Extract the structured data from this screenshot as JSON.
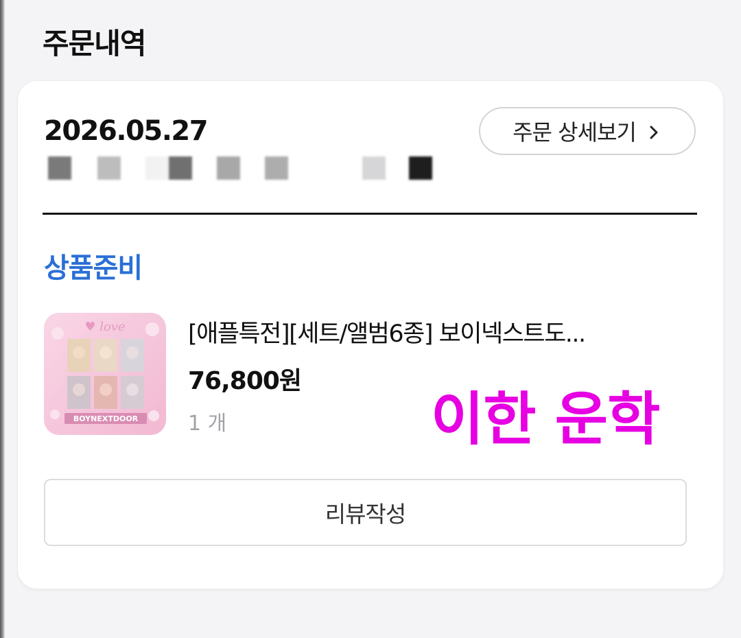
{
  "page": {
    "title": "주문내역"
  },
  "order": {
    "date": "2026.05.27",
    "detail_button": "주문 상세보기",
    "status": "상품준비",
    "product": {
      "name": "[애플특전][세트/앨범6종] 보이넥스트도...",
      "price": "76,800원",
      "quantity": "1 개",
      "thumbnail_title": "BOYNEXTDOOR"
    },
    "review_button": "리뷰작성"
  },
  "overlay": {
    "text": "이한 운학"
  },
  "colors": {
    "status_blue": "#2a6fd6",
    "overlay_magenta": "#e600e2",
    "thumb_pink": "#f6c6dc"
  },
  "icons": {
    "detail_arrow": "chevron-right-icon"
  }
}
